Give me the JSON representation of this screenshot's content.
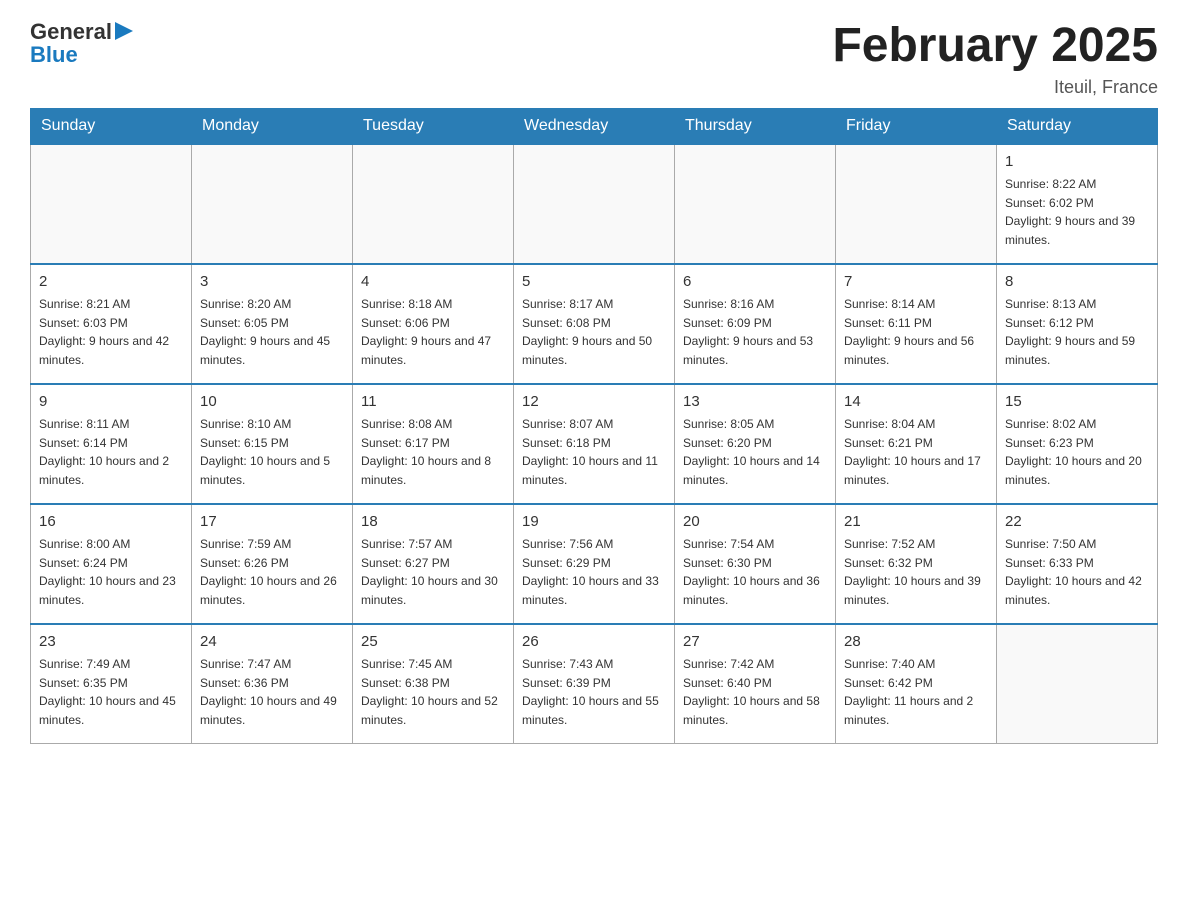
{
  "logo": {
    "general": "General",
    "blue": "Blue"
  },
  "title": "February 2025",
  "subtitle": "Iteuil, France",
  "days_of_week": [
    "Sunday",
    "Monday",
    "Tuesday",
    "Wednesday",
    "Thursday",
    "Friday",
    "Saturday"
  ],
  "weeks": [
    [
      {
        "num": "",
        "info": ""
      },
      {
        "num": "",
        "info": ""
      },
      {
        "num": "",
        "info": ""
      },
      {
        "num": "",
        "info": ""
      },
      {
        "num": "",
        "info": ""
      },
      {
        "num": "",
        "info": ""
      },
      {
        "num": "1",
        "info": "Sunrise: 8:22 AM\nSunset: 6:02 PM\nDaylight: 9 hours and 39 minutes."
      }
    ],
    [
      {
        "num": "2",
        "info": "Sunrise: 8:21 AM\nSunset: 6:03 PM\nDaylight: 9 hours and 42 minutes."
      },
      {
        "num": "3",
        "info": "Sunrise: 8:20 AM\nSunset: 6:05 PM\nDaylight: 9 hours and 45 minutes."
      },
      {
        "num": "4",
        "info": "Sunrise: 8:18 AM\nSunset: 6:06 PM\nDaylight: 9 hours and 47 minutes."
      },
      {
        "num": "5",
        "info": "Sunrise: 8:17 AM\nSunset: 6:08 PM\nDaylight: 9 hours and 50 minutes."
      },
      {
        "num": "6",
        "info": "Sunrise: 8:16 AM\nSunset: 6:09 PM\nDaylight: 9 hours and 53 minutes."
      },
      {
        "num": "7",
        "info": "Sunrise: 8:14 AM\nSunset: 6:11 PM\nDaylight: 9 hours and 56 minutes."
      },
      {
        "num": "8",
        "info": "Sunrise: 8:13 AM\nSunset: 6:12 PM\nDaylight: 9 hours and 59 minutes."
      }
    ],
    [
      {
        "num": "9",
        "info": "Sunrise: 8:11 AM\nSunset: 6:14 PM\nDaylight: 10 hours and 2 minutes."
      },
      {
        "num": "10",
        "info": "Sunrise: 8:10 AM\nSunset: 6:15 PM\nDaylight: 10 hours and 5 minutes."
      },
      {
        "num": "11",
        "info": "Sunrise: 8:08 AM\nSunset: 6:17 PM\nDaylight: 10 hours and 8 minutes."
      },
      {
        "num": "12",
        "info": "Sunrise: 8:07 AM\nSunset: 6:18 PM\nDaylight: 10 hours and 11 minutes."
      },
      {
        "num": "13",
        "info": "Sunrise: 8:05 AM\nSunset: 6:20 PM\nDaylight: 10 hours and 14 minutes."
      },
      {
        "num": "14",
        "info": "Sunrise: 8:04 AM\nSunset: 6:21 PM\nDaylight: 10 hours and 17 minutes."
      },
      {
        "num": "15",
        "info": "Sunrise: 8:02 AM\nSunset: 6:23 PM\nDaylight: 10 hours and 20 minutes."
      }
    ],
    [
      {
        "num": "16",
        "info": "Sunrise: 8:00 AM\nSunset: 6:24 PM\nDaylight: 10 hours and 23 minutes."
      },
      {
        "num": "17",
        "info": "Sunrise: 7:59 AM\nSunset: 6:26 PM\nDaylight: 10 hours and 26 minutes."
      },
      {
        "num": "18",
        "info": "Sunrise: 7:57 AM\nSunset: 6:27 PM\nDaylight: 10 hours and 30 minutes."
      },
      {
        "num": "19",
        "info": "Sunrise: 7:56 AM\nSunset: 6:29 PM\nDaylight: 10 hours and 33 minutes."
      },
      {
        "num": "20",
        "info": "Sunrise: 7:54 AM\nSunset: 6:30 PM\nDaylight: 10 hours and 36 minutes."
      },
      {
        "num": "21",
        "info": "Sunrise: 7:52 AM\nSunset: 6:32 PM\nDaylight: 10 hours and 39 minutes."
      },
      {
        "num": "22",
        "info": "Sunrise: 7:50 AM\nSunset: 6:33 PM\nDaylight: 10 hours and 42 minutes."
      }
    ],
    [
      {
        "num": "23",
        "info": "Sunrise: 7:49 AM\nSunset: 6:35 PM\nDaylight: 10 hours and 45 minutes."
      },
      {
        "num": "24",
        "info": "Sunrise: 7:47 AM\nSunset: 6:36 PM\nDaylight: 10 hours and 49 minutes."
      },
      {
        "num": "25",
        "info": "Sunrise: 7:45 AM\nSunset: 6:38 PM\nDaylight: 10 hours and 52 minutes."
      },
      {
        "num": "26",
        "info": "Sunrise: 7:43 AM\nSunset: 6:39 PM\nDaylight: 10 hours and 55 minutes."
      },
      {
        "num": "27",
        "info": "Sunrise: 7:42 AM\nSunset: 6:40 PM\nDaylight: 10 hours and 58 minutes."
      },
      {
        "num": "28",
        "info": "Sunrise: 7:40 AM\nSunset: 6:42 PM\nDaylight: 11 hours and 2 minutes."
      },
      {
        "num": "",
        "info": ""
      }
    ]
  ]
}
